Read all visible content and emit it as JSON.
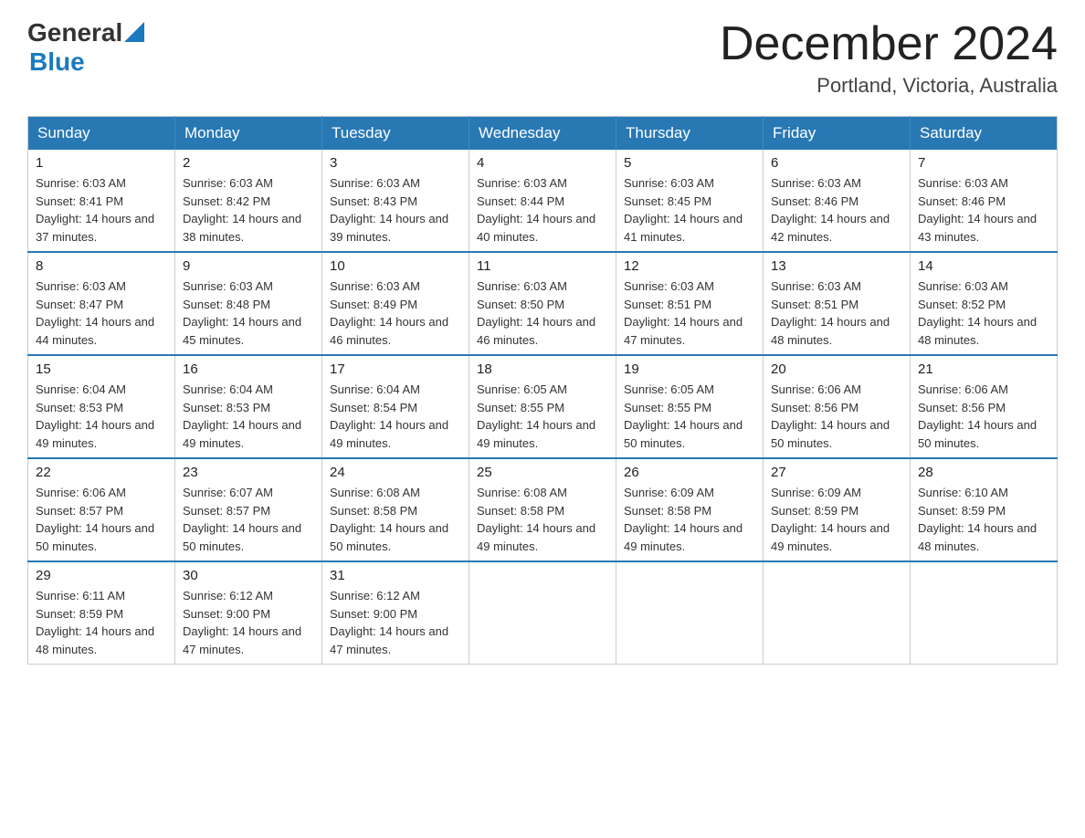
{
  "logo": {
    "general": "General",
    "blue": "Blue"
  },
  "title": {
    "month": "December 2024",
    "location": "Portland, Victoria, Australia"
  },
  "days_of_week": [
    "Sunday",
    "Monday",
    "Tuesday",
    "Wednesday",
    "Thursday",
    "Friday",
    "Saturday"
  ],
  "weeks": [
    [
      {
        "day": "1",
        "sunrise": "6:03 AM",
        "sunset": "8:41 PM",
        "daylight": "14 hours and 37 minutes."
      },
      {
        "day": "2",
        "sunrise": "6:03 AM",
        "sunset": "8:42 PM",
        "daylight": "14 hours and 38 minutes."
      },
      {
        "day": "3",
        "sunrise": "6:03 AM",
        "sunset": "8:43 PM",
        "daylight": "14 hours and 39 minutes."
      },
      {
        "day": "4",
        "sunrise": "6:03 AM",
        "sunset": "8:44 PM",
        "daylight": "14 hours and 40 minutes."
      },
      {
        "day": "5",
        "sunrise": "6:03 AM",
        "sunset": "8:45 PM",
        "daylight": "14 hours and 41 minutes."
      },
      {
        "day": "6",
        "sunrise": "6:03 AM",
        "sunset": "8:46 PM",
        "daylight": "14 hours and 42 minutes."
      },
      {
        "day": "7",
        "sunrise": "6:03 AM",
        "sunset": "8:46 PM",
        "daylight": "14 hours and 43 minutes."
      }
    ],
    [
      {
        "day": "8",
        "sunrise": "6:03 AM",
        "sunset": "8:47 PM",
        "daylight": "14 hours and 44 minutes."
      },
      {
        "day": "9",
        "sunrise": "6:03 AM",
        "sunset": "8:48 PM",
        "daylight": "14 hours and 45 minutes."
      },
      {
        "day": "10",
        "sunrise": "6:03 AM",
        "sunset": "8:49 PM",
        "daylight": "14 hours and 46 minutes."
      },
      {
        "day": "11",
        "sunrise": "6:03 AM",
        "sunset": "8:50 PM",
        "daylight": "14 hours and 46 minutes."
      },
      {
        "day": "12",
        "sunrise": "6:03 AM",
        "sunset": "8:51 PM",
        "daylight": "14 hours and 47 minutes."
      },
      {
        "day": "13",
        "sunrise": "6:03 AM",
        "sunset": "8:51 PM",
        "daylight": "14 hours and 48 minutes."
      },
      {
        "day": "14",
        "sunrise": "6:03 AM",
        "sunset": "8:52 PM",
        "daylight": "14 hours and 48 minutes."
      }
    ],
    [
      {
        "day": "15",
        "sunrise": "6:04 AM",
        "sunset": "8:53 PM",
        "daylight": "14 hours and 49 minutes."
      },
      {
        "day": "16",
        "sunrise": "6:04 AM",
        "sunset": "8:53 PM",
        "daylight": "14 hours and 49 minutes."
      },
      {
        "day": "17",
        "sunrise": "6:04 AM",
        "sunset": "8:54 PM",
        "daylight": "14 hours and 49 minutes."
      },
      {
        "day": "18",
        "sunrise": "6:05 AM",
        "sunset": "8:55 PM",
        "daylight": "14 hours and 49 minutes."
      },
      {
        "day": "19",
        "sunrise": "6:05 AM",
        "sunset": "8:55 PM",
        "daylight": "14 hours and 50 minutes."
      },
      {
        "day": "20",
        "sunrise": "6:06 AM",
        "sunset": "8:56 PM",
        "daylight": "14 hours and 50 minutes."
      },
      {
        "day": "21",
        "sunrise": "6:06 AM",
        "sunset": "8:56 PM",
        "daylight": "14 hours and 50 minutes."
      }
    ],
    [
      {
        "day": "22",
        "sunrise": "6:06 AM",
        "sunset": "8:57 PM",
        "daylight": "14 hours and 50 minutes."
      },
      {
        "day": "23",
        "sunrise": "6:07 AM",
        "sunset": "8:57 PM",
        "daylight": "14 hours and 50 minutes."
      },
      {
        "day": "24",
        "sunrise": "6:08 AM",
        "sunset": "8:58 PM",
        "daylight": "14 hours and 50 minutes."
      },
      {
        "day": "25",
        "sunrise": "6:08 AM",
        "sunset": "8:58 PM",
        "daylight": "14 hours and 49 minutes."
      },
      {
        "day": "26",
        "sunrise": "6:09 AM",
        "sunset": "8:58 PM",
        "daylight": "14 hours and 49 minutes."
      },
      {
        "day": "27",
        "sunrise": "6:09 AM",
        "sunset": "8:59 PM",
        "daylight": "14 hours and 49 minutes."
      },
      {
        "day": "28",
        "sunrise": "6:10 AM",
        "sunset": "8:59 PM",
        "daylight": "14 hours and 48 minutes."
      }
    ],
    [
      {
        "day": "29",
        "sunrise": "6:11 AM",
        "sunset": "8:59 PM",
        "daylight": "14 hours and 48 minutes."
      },
      {
        "day": "30",
        "sunrise": "6:12 AM",
        "sunset": "9:00 PM",
        "daylight": "14 hours and 47 minutes."
      },
      {
        "day": "31",
        "sunrise": "6:12 AM",
        "sunset": "9:00 PM",
        "daylight": "14 hours and 47 minutes."
      },
      null,
      null,
      null,
      null
    ]
  ]
}
